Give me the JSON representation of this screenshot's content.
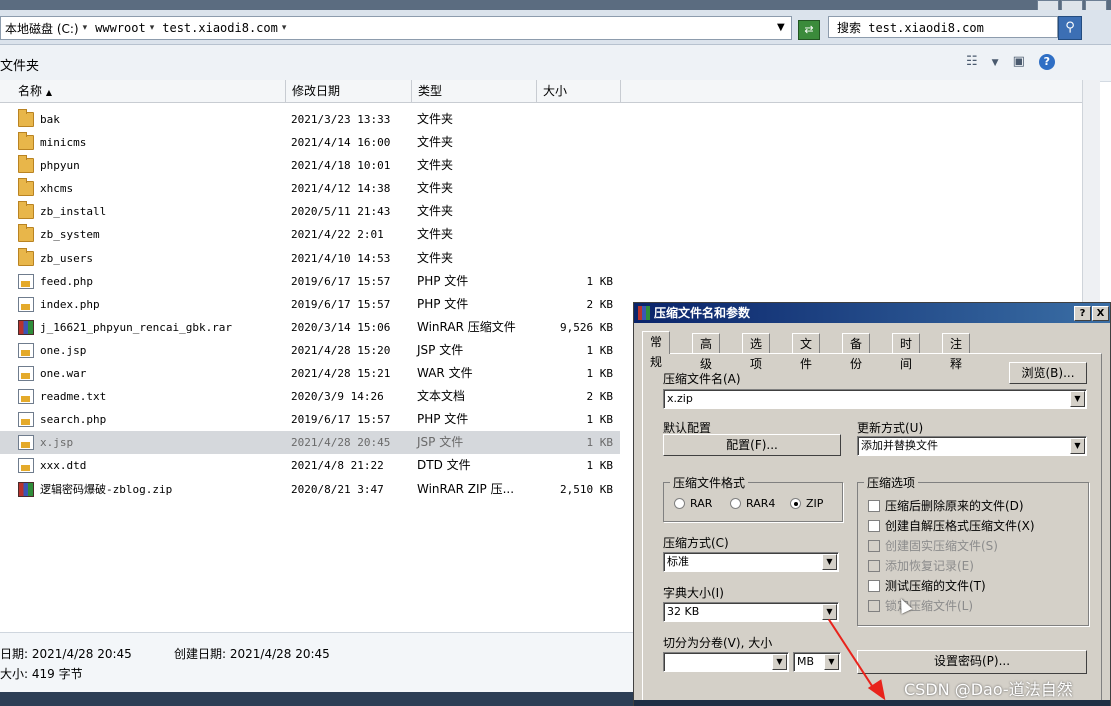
{
  "address": {
    "crumbs": [
      "本地磁盘 (C:)",
      "wwwroot",
      "test.xiaodi8.com"
    ],
    "search_placeholder": "搜索 test.xiaodi8.com"
  },
  "toolbar": {
    "label": "文件夹"
  },
  "columns": {
    "name": "名称",
    "date": "修改日期",
    "type": "类型",
    "size": "大小"
  },
  "files": [
    {
      "icon": "folder",
      "name": "bak",
      "date": "2021/3/23 13:33",
      "type": "文件夹",
      "size": ""
    },
    {
      "icon": "folder",
      "name": "minicms",
      "date": "2021/4/14 16:00",
      "type": "文件夹",
      "size": ""
    },
    {
      "icon": "folder",
      "name": "phpyun",
      "date": "2021/4/18 10:01",
      "type": "文件夹",
      "size": ""
    },
    {
      "icon": "folder",
      "name": "xhcms",
      "date": "2021/4/12 14:38",
      "type": "文件夹",
      "size": ""
    },
    {
      "icon": "folder",
      "name": "zb_install",
      "date": "2020/5/11 21:43",
      "type": "文件夹",
      "size": ""
    },
    {
      "icon": "folder",
      "name": "zb_system",
      "date": "2021/4/22 2:01",
      "type": "文件夹",
      "size": ""
    },
    {
      "icon": "folder",
      "name": "zb_users",
      "date": "2021/4/10 14:53",
      "type": "文件夹",
      "size": ""
    },
    {
      "icon": "file",
      "name": "feed.php",
      "date": "2019/6/17 15:57",
      "type": "PHP 文件",
      "size": "1 KB"
    },
    {
      "icon": "file",
      "name": "index.php",
      "date": "2019/6/17 15:57",
      "type": "PHP 文件",
      "size": "2 KB"
    },
    {
      "icon": "rar",
      "name": "j_16621_phpyun_rencai_gbk.rar",
      "date": "2020/3/14 15:06",
      "type": "WinRAR 压缩文件",
      "size": "9,526 KB"
    },
    {
      "icon": "file",
      "name": "one.jsp",
      "date": "2021/4/28 15:20",
      "type": "JSP 文件",
      "size": "1 KB"
    },
    {
      "icon": "file",
      "name": "one.war",
      "date": "2021/4/28 15:21",
      "type": "WAR 文件",
      "size": "1 KB"
    },
    {
      "icon": "file",
      "name": "readme.txt",
      "date": "2020/3/9 14:26",
      "type": "文本文档",
      "size": "2 KB"
    },
    {
      "icon": "file",
      "name": "search.php",
      "date": "2019/6/17 15:57",
      "type": "PHP 文件",
      "size": "1 KB"
    },
    {
      "icon": "file",
      "name": "x.jsp",
      "date": "2021/4/28 20:45",
      "type": "JSP 文件",
      "size": "1 KB",
      "selected": true
    },
    {
      "icon": "file",
      "name": "xxx.dtd",
      "date": "2021/4/8 21:22",
      "type": "DTD 文件",
      "size": "1 KB"
    },
    {
      "icon": "rar",
      "name": "逻辑密码爆破-zblog.zip",
      "date": "2020/8/21 3:47",
      "type": "WinRAR ZIP 压...",
      "size": "2,510 KB"
    }
  ],
  "details": {
    "modified": "日期: 2021/4/28 20:45",
    "created": "创建日期: 2021/4/28 20:45",
    "size": "大小: 419 字节"
  },
  "dialog": {
    "title": "压缩文件名和参数",
    "help_btn": "?",
    "close_btn": "X",
    "tabs": [
      "常规",
      "高级",
      "选项",
      "文件",
      "备份",
      "时间",
      "注释"
    ],
    "archive_name_label": "压缩文件名(A)",
    "archive_name_value": "x.zip",
    "browse_btn": "浏览(B)...",
    "profiles_label": "默认配置",
    "profiles_btn": "配置(F)...",
    "update_mode_label": "更新方式(U)",
    "update_mode_value": "添加并替换文件",
    "format_label": "压缩文件格式",
    "format_options": [
      "RAR",
      "RAR4",
      "ZIP"
    ],
    "format_selected": "ZIP",
    "method_label": "压缩方式(C)",
    "method_value": "标准",
    "dict_label": "字典大小(I)",
    "dict_value": "32 KB",
    "split_label": "切分为分卷(V), 大小",
    "split_value": "",
    "split_unit": "MB",
    "options_label": "压缩选项",
    "options": [
      {
        "label": "压缩后删除原来的文件(D)",
        "enabled": true
      },
      {
        "label": "创建自解压格式压缩文件(X)",
        "enabled": true
      },
      {
        "label": "创建固实压缩文件(S)",
        "enabled": false
      },
      {
        "label": "添加恢复记录(E)",
        "enabled": false
      },
      {
        "label": "测试压缩的文件(T)",
        "enabled": true
      },
      {
        "label": "锁定压缩文件(L)",
        "enabled": false
      }
    ],
    "password_btn": "设置密码(P)..."
  },
  "watermark": "CSDN @Dao-道法自然",
  "colors": {
    "accent_arrow": "#e8231c",
    "dialog_bg": "#d4d0c8",
    "title_bar": "#0a246a"
  }
}
